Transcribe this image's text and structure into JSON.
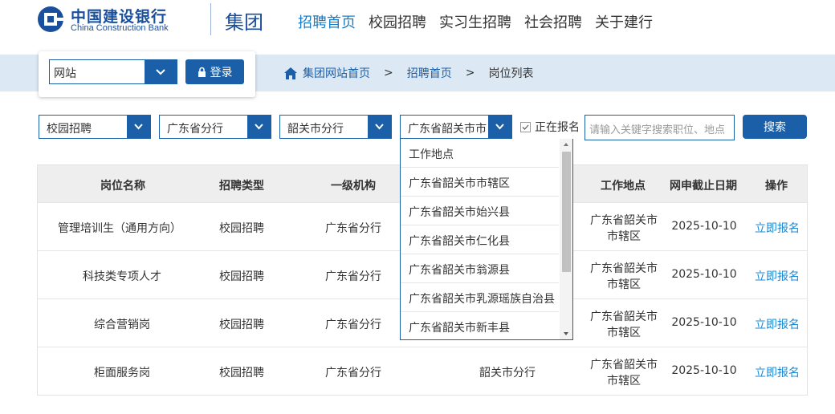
{
  "brand": {
    "name_cn": "中国建设银行",
    "name_en": "China Construction Bank",
    "group": "集团",
    "color": "#1a4f9e"
  },
  "nav": [
    {
      "label": "招聘首页",
      "active": true
    },
    {
      "label": "校园招聘"
    },
    {
      "label": "实习生招聘"
    },
    {
      "label": "社会招聘"
    },
    {
      "label": "关于建行"
    }
  ],
  "login": {
    "site_select": "网站",
    "login_label": "登录"
  },
  "breadcrumb": {
    "home": "集团网站首页",
    "recruit": "招聘首页",
    "current": "岗位列表",
    "sep": ">"
  },
  "filters": {
    "type": "校园招聘",
    "province": "广东省分行",
    "city": "韶关市分行",
    "location": "广东省韶关市市",
    "open_only_label": "正在报名",
    "open_only_checked": true,
    "search_placeholder": "请输入关键字搜索职位、地点",
    "search_label": "搜索"
  },
  "location_dropdown": [
    "工作地点",
    "广东省韶关市市辖区",
    "广东省韶关市始兴县",
    "广东省韶关市仁化县",
    "广东省韶关市翁源县",
    "广东省韶关市乳源瑶族自治县",
    "广东省韶关市新丰县"
  ],
  "table": {
    "headers": {
      "position": "岗位名称",
      "type": "招聘类型",
      "org1": "一级机构",
      "location": "工作地点",
      "deadline": "网申截止日期",
      "action": "操作"
    },
    "rows": [
      {
        "position": "管理培训生（通用方向）",
        "type": "校园招聘",
        "org1": "广东省分行",
        "org2": "",
        "location_1": "广东省韶关市",
        "location_2": "市辖区",
        "deadline": "2025-10-10",
        "action": "立即报名"
      },
      {
        "position": "科技类专项人才",
        "type": "校园招聘",
        "org1": "广东省分行",
        "org2": "",
        "location_1": "广东省韶关市",
        "location_2": "市辖区",
        "deadline": "2025-10-10",
        "action": "立即报名"
      },
      {
        "position": "综合营销岗",
        "type": "校园招聘",
        "org1": "广东省分行",
        "org2": "",
        "location_1": "广东省韶关市",
        "location_2": "市辖区",
        "deadline": "2025-10-10",
        "action": "立即报名"
      },
      {
        "position": "柜面服务岗",
        "type": "校园招聘",
        "org1": "广东省分行",
        "org2": "韶关市分行",
        "location_1": "广东省韶关市",
        "location_2": "市辖区",
        "deadline": "2025-10-10",
        "action": "立即报名"
      }
    ]
  },
  "colors": {
    "primary": "#1a5fa8",
    "link": "#1a8ad4",
    "band": "#dce9f5"
  }
}
